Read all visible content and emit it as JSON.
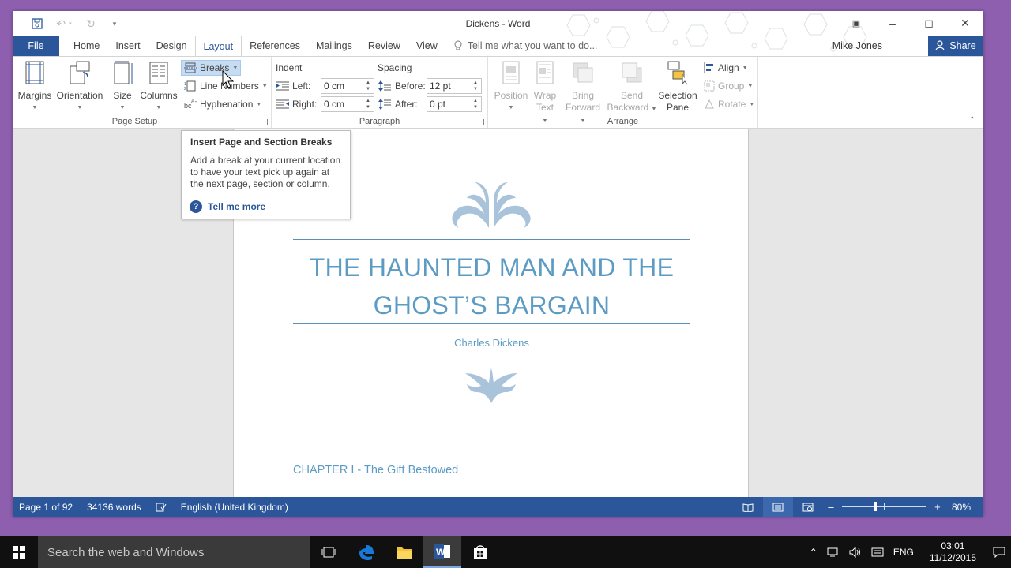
{
  "window": {
    "title": "Dickens - Word",
    "controls": {
      "minimize": "–",
      "maximize": "◻",
      "close": "✕"
    }
  },
  "qat": {
    "save_icon": "save-icon",
    "undo_icon": "undo-icon",
    "redo_icon": "redo-icon",
    "customize_icon": "customize-icon"
  },
  "tabs": {
    "file": "File",
    "items": [
      "Home",
      "Insert",
      "Design",
      "Layout",
      "References",
      "Mailings",
      "Review",
      "View"
    ],
    "active": "Layout",
    "tell_me": "Tell me what you want to do..."
  },
  "user": {
    "name": "Mike Jones",
    "share": "Share"
  },
  "ribbon": {
    "page_setup": {
      "label": "Page Setup",
      "margins": "Margins",
      "orientation": "Orientation",
      "size": "Size",
      "columns": "Columns",
      "breaks": "Breaks",
      "line_numbers": "Line Numbers",
      "hyphenation": "Hyphenation"
    },
    "paragraph": {
      "label": "Paragraph",
      "indent": "Indent",
      "spacing": "Spacing",
      "left_label": "Left:",
      "left_value": "0 cm",
      "right_label": "Right:",
      "right_value": "0 cm",
      "before_label": "Before:",
      "before_value": "12 pt",
      "after_label": "After:",
      "after_value": "0 pt"
    },
    "arrange": {
      "label": "Arrange",
      "position": "Position",
      "wrap_text_1": "Wrap",
      "wrap_text_2": "Text",
      "bring_forward_1": "Bring",
      "bring_forward_2": "Forward",
      "send_backward_1": "Send",
      "send_backward_2": "Backward",
      "selection_pane_1": "Selection",
      "selection_pane_2": "Pane",
      "align": "Align",
      "group": "Group",
      "rotate": "Rotate"
    }
  },
  "tooltip": {
    "title": "Insert Page and Section Breaks",
    "body": "Add a break at your current location to have your text pick up again at the next page, section or column.",
    "more": "Tell me more"
  },
  "document": {
    "title_line1": "THE HAUNTED MAN AND THE",
    "title_line2": "GHOST’S BARGAIN",
    "author": "Charles Dickens",
    "chapter": "CHAPTER I - The Gift Bestowed"
  },
  "status": {
    "page": "Page 1 of 92",
    "words": "34136 words",
    "language": "English (United Kingdom)",
    "zoom_percent": 80,
    "zoom_label": "80%"
  },
  "taskbar": {
    "search": "Search the web and Windows",
    "language": "ENG",
    "time": "03:01",
    "date": "11/12/2015"
  },
  "colors": {
    "accent": "#2b579a",
    "doc_text": "#5b9bc4",
    "desktop": "#8e5fae"
  }
}
